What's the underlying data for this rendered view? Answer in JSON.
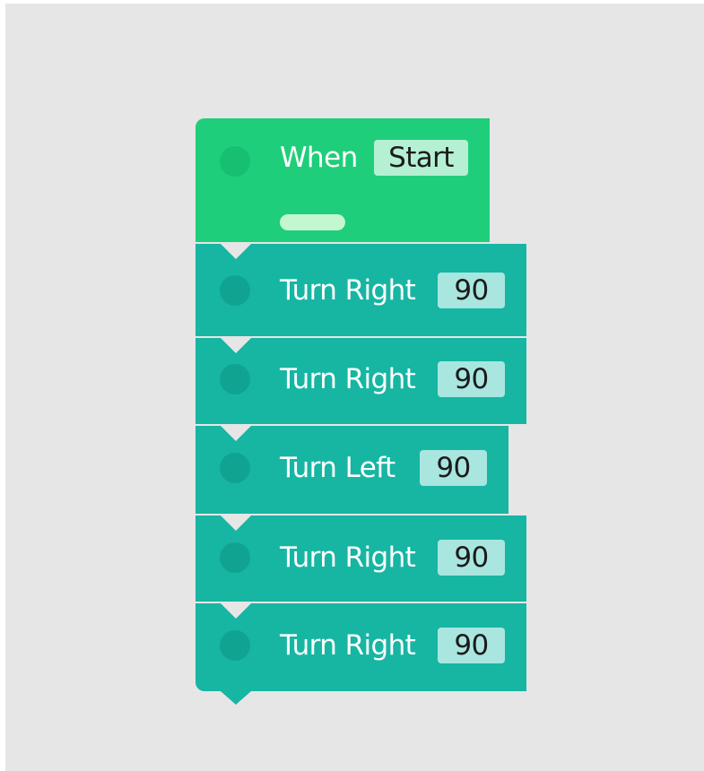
{
  "hat_block": {
    "label": "When",
    "trigger": "Start",
    "color": "#1fce7a"
  },
  "motion_blocks": [
    {
      "label": "Turn Right",
      "value": "90"
    },
    {
      "label": "Turn Right",
      "value": "90"
    },
    {
      "label": "Turn Left",
      "value": "90"
    },
    {
      "label": "Turn Right",
      "value": "90"
    },
    {
      "label": "Turn Right",
      "value": "90"
    }
  ],
  "colors": {
    "canvas": "#e6e6e6",
    "hat_block": "#1fce7a",
    "motion_block": "#16b6a3",
    "block_dot_hat": "#17c071",
    "block_dot_motion": "#11a391",
    "param_hat": "#b5f0d3",
    "param_motion": "#a8e6df",
    "hat_handle": "#c3f7cf"
  }
}
